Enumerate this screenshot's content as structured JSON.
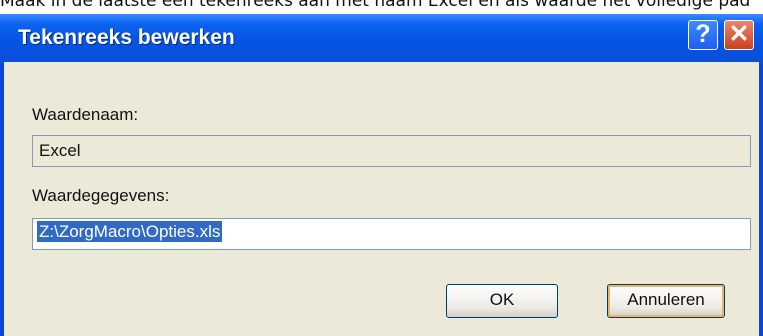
{
  "background_text": "Maak in de laatste een tekenreeks aan met naam Excel en als waarde het volledige pad",
  "dialog": {
    "title": "Tekenreeks bewerken",
    "help_button": "?",
    "close_button": "✕",
    "value_name_label": "Waardenaam:",
    "value_name": "Excel",
    "value_data_label": "Waardegegevens:",
    "value_data": "Z:\\ZorgMacro\\Opties.xls",
    "ok_label": "OK",
    "cancel_label": "Annuleren"
  },
  "colors": {
    "titlebar": "#0554e3",
    "client": "#ece9d8",
    "selection": "#316ac5"
  }
}
